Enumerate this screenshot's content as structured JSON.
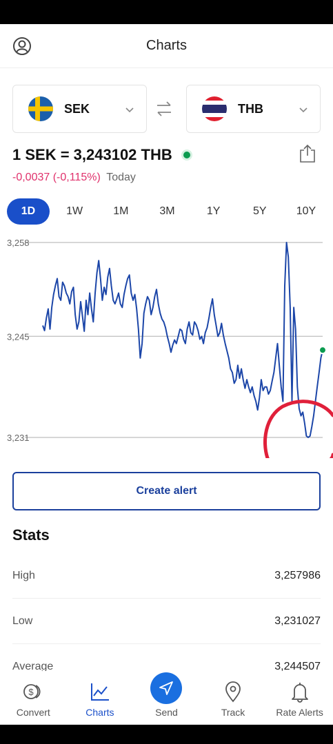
{
  "header": {
    "title": "Charts"
  },
  "pair": {
    "from": {
      "code": "SEK"
    },
    "to": {
      "code": "THB"
    }
  },
  "rate": {
    "text": "1 SEK = 3,243102 THB",
    "change": "-0,0037 (-0,115%)",
    "period_label": "Today"
  },
  "periods": [
    "1D",
    "1W",
    "1M",
    "3M",
    "1Y",
    "5Y",
    "10Y"
  ],
  "active_period": "1D",
  "chart_data": {
    "type": "line",
    "ytick_labels": [
      "3,258",
      "3,245",
      "3,231"
    ],
    "yticks": [
      3.258,
      3.245,
      3.231
    ],
    "ylim": [
      3.231,
      3.258
    ],
    "series": [
      {
        "values": [
          3.2465,
          3.2458,
          3.2475,
          3.2488,
          3.246,
          3.249,
          3.2508,
          3.252,
          3.253,
          3.2505,
          3.25,
          3.2525,
          3.252,
          3.251,
          3.2505,
          3.2495,
          3.2512,
          3.2518,
          3.248,
          3.246,
          3.247,
          3.2498,
          3.2478,
          3.2457,
          3.25,
          3.248,
          3.251,
          3.2488,
          3.247,
          3.251,
          3.2538,
          3.2555,
          3.253,
          3.25,
          3.2518,
          3.2508,
          3.2532,
          3.2544,
          3.252,
          3.25,
          3.2495,
          3.2502,
          3.251,
          3.2495,
          3.249,
          3.2508,
          3.252,
          3.253,
          3.2535,
          3.251,
          3.25,
          3.2508,
          3.2488,
          3.246,
          3.242,
          3.244,
          3.2482,
          3.2495,
          3.2505,
          3.25,
          3.248,
          3.249,
          3.2505,
          3.2515,
          3.2495,
          3.2482,
          3.2474,
          3.247,
          3.2462,
          3.245,
          3.244,
          3.2428,
          3.2438,
          3.2445,
          3.244,
          3.245,
          3.246,
          3.2458,
          3.2446,
          3.244,
          3.246,
          3.247,
          3.2455,
          3.2452,
          3.247,
          3.2466,
          3.2458,
          3.2446,
          3.245,
          3.244,
          3.2455,
          3.2462,
          3.2475,
          3.249,
          3.2502,
          3.248,
          3.2465,
          3.245,
          3.2455,
          3.2468,
          3.2452,
          3.244,
          3.243,
          3.242,
          3.2405,
          3.24,
          3.2385,
          3.239,
          3.241,
          3.2392,
          3.2405,
          3.239,
          3.2378,
          3.239,
          3.238,
          3.2372,
          3.238,
          3.2368,
          3.236,
          3.2348,
          3.2365,
          3.239,
          3.2375,
          3.238,
          3.238,
          3.237,
          3.2375,
          3.2388,
          3.24,
          3.242,
          3.244,
          3.241,
          3.238,
          3.236,
          3.252,
          3.258,
          3.256,
          3.249,
          3.236,
          3.249,
          3.246,
          3.238,
          3.235,
          3.234,
          3.2345,
          3.233,
          3.2312,
          3.231,
          3.2312,
          3.2325,
          3.234,
          3.236,
          3.238,
          3.24,
          3.242,
          3.2431
        ]
      }
    ]
  },
  "create_alert_label": "Create alert",
  "stats": {
    "title": "Stats",
    "rows": [
      {
        "label": "High",
        "value": "3,257986"
      },
      {
        "label": "Low",
        "value": "3,231027"
      },
      {
        "label": "Average",
        "value": "3,244507"
      }
    ]
  },
  "nav": {
    "items": [
      {
        "label": "Convert",
        "icon": "convert-icon"
      },
      {
        "label": "Charts",
        "icon": "charts-icon"
      },
      {
        "label": "Send",
        "icon": "send-icon"
      },
      {
        "label": "Track",
        "icon": "track-icon"
      },
      {
        "label": "Rate Alerts",
        "icon": "bell-icon"
      }
    ],
    "active": "Charts"
  },
  "colors": {
    "accent": "#1a4fc9",
    "line": "#1c46a8",
    "negative": "#e0306b",
    "live": "#0a9b4f",
    "annotation": "#e0203a"
  }
}
